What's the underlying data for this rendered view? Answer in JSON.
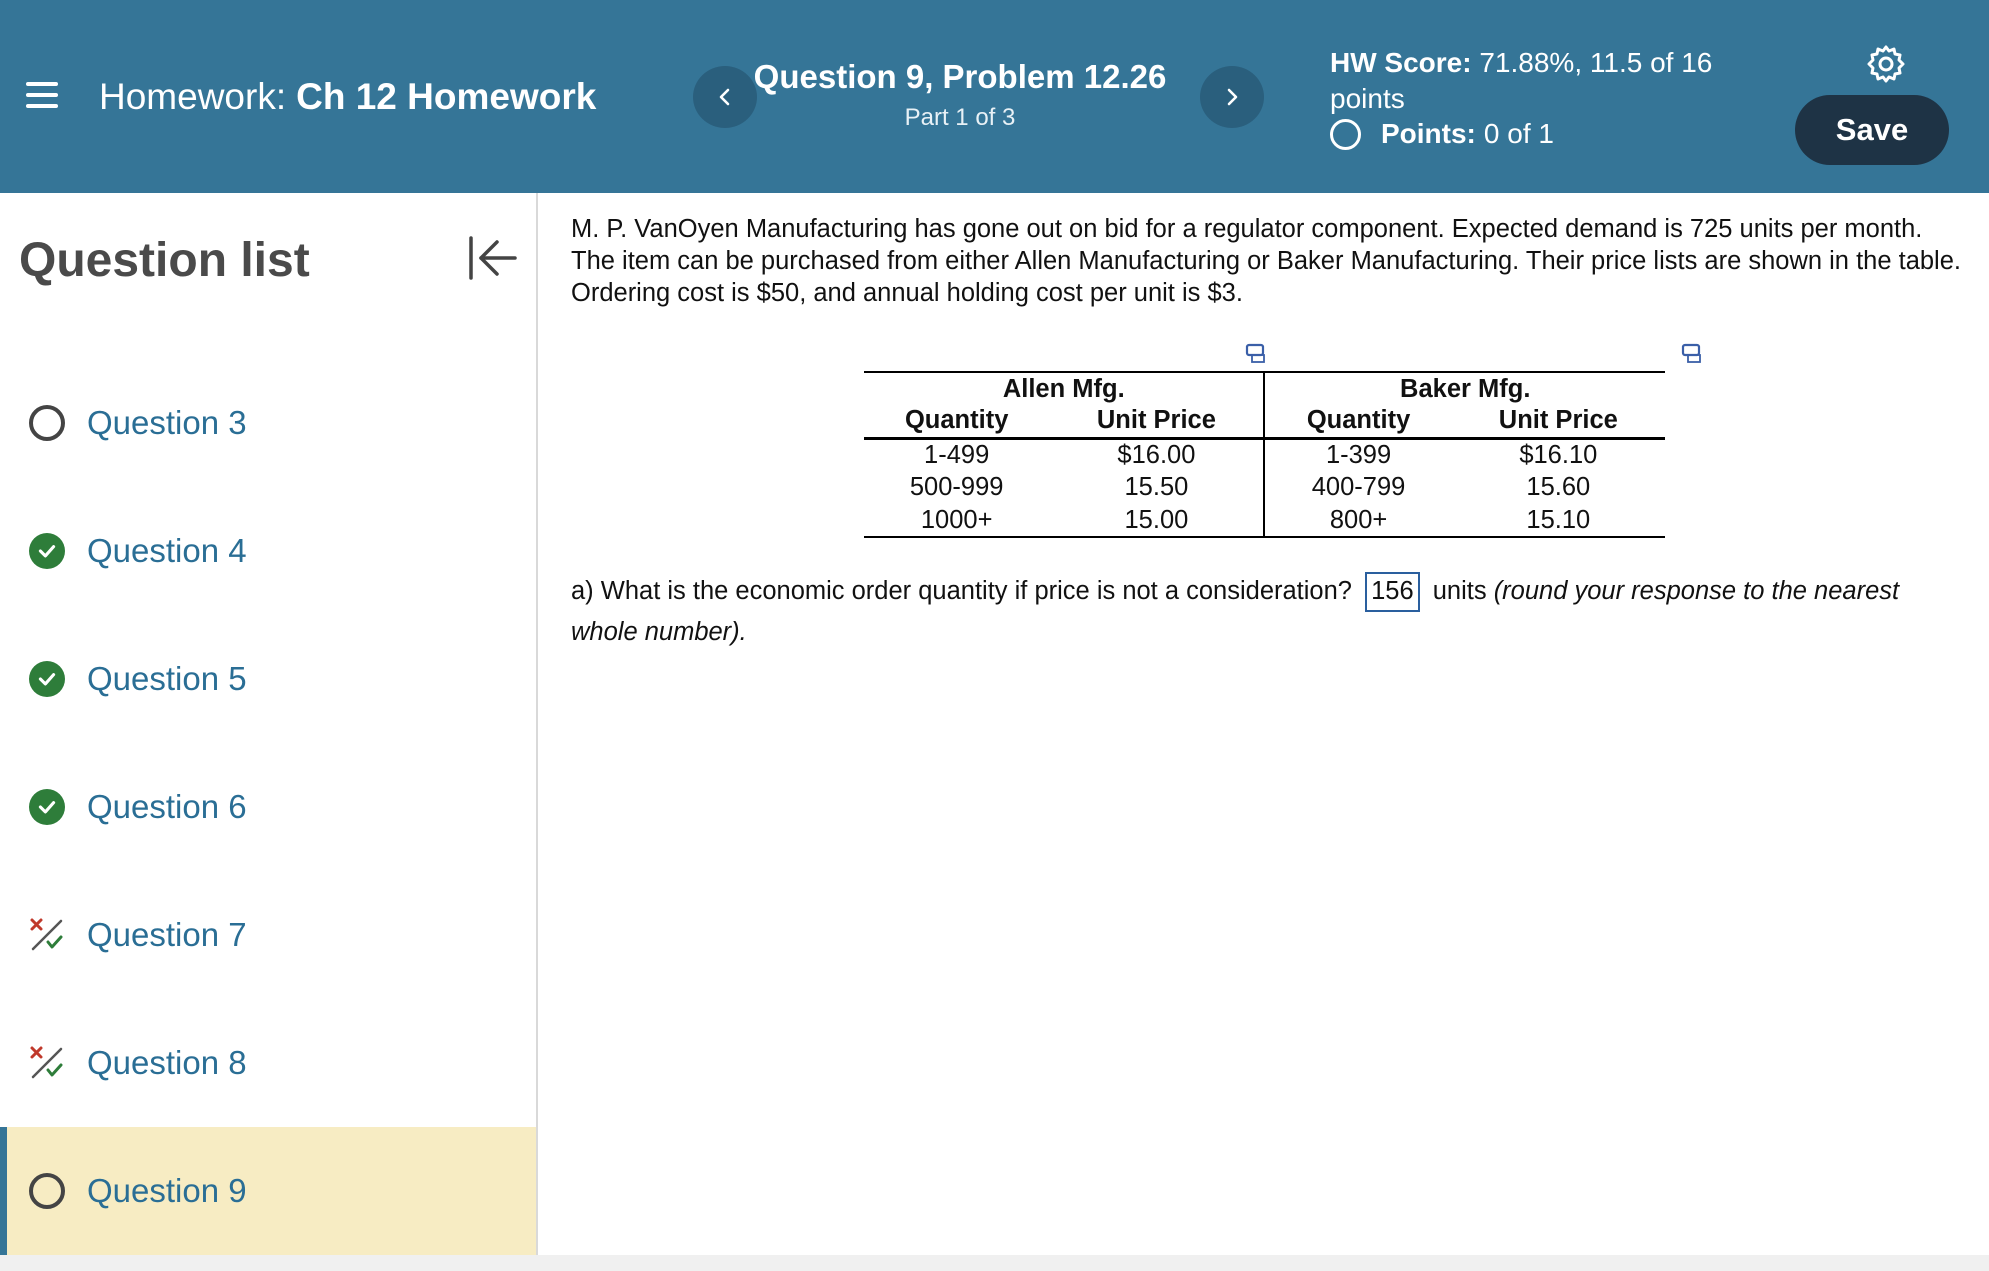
{
  "header": {
    "homework_prefix": "Homework:",
    "homework_name": "Ch 12 Homework",
    "question_title": "Question 9, Problem 12.26",
    "part_text": "Part 1 of 3",
    "hw_score_label": "HW Score:",
    "hw_score_value": "71.88%, 11.5 of 16 points",
    "points_label": "Points:",
    "points_value": "0 of 1",
    "save_label": "Save"
  },
  "sidebar": {
    "title": "Question list",
    "items": [
      {
        "label": "Question 3",
        "status": "not-attempted"
      },
      {
        "label": "Question 4",
        "status": "correct"
      },
      {
        "label": "Question 5",
        "status": "correct"
      },
      {
        "label": "Question 6",
        "status": "correct"
      },
      {
        "label": "Question 7",
        "status": "partial"
      },
      {
        "label": "Question 8",
        "status": "partial"
      },
      {
        "label": "Question 9",
        "status": "current"
      }
    ]
  },
  "problem": {
    "text": "M. P. VanOyen Manufacturing has gone out on bid for a regulator component. Expected demand is 725 units per month. The item can be purchased from either Allen Manufacturing or Baker Manufacturing. Their price lists are shown in the table. Ordering cost is $50, and annual holding cost per unit is $3.",
    "table": {
      "vendors": [
        "Allen Mfg.",
        "Baker Mfg."
      ],
      "columns": [
        "Quantity",
        "Unit Price",
        "Quantity",
        "Unit Price"
      ],
      "rows": [
        [
          "1-499",
          "$16.00",
          "1-399",
          "$16.10"
        ],
        [
          "500-999",
          "15.50",
          "400-799",
          "15.60"
        ],
        [
          "1000+",
          "15.00",
          "800+",
          "15.10"
        ]
      ]
    },
    "part_a_prompt": "a) What is the economic order quantity if price is not a consideration?",
    "part_a_answer": "156",
    "part_a_units": "units",
    "part_a_hint": "(round your response to the nearest whole number)."
  },
  "colors": {
    "header_bg": "#357597",
    "save_bg": "#1e3345",
    "link": "#2a6e95",
    "correct": "#2e7d3a",
    "active_bg": "#f7ecc3"
  }
}
